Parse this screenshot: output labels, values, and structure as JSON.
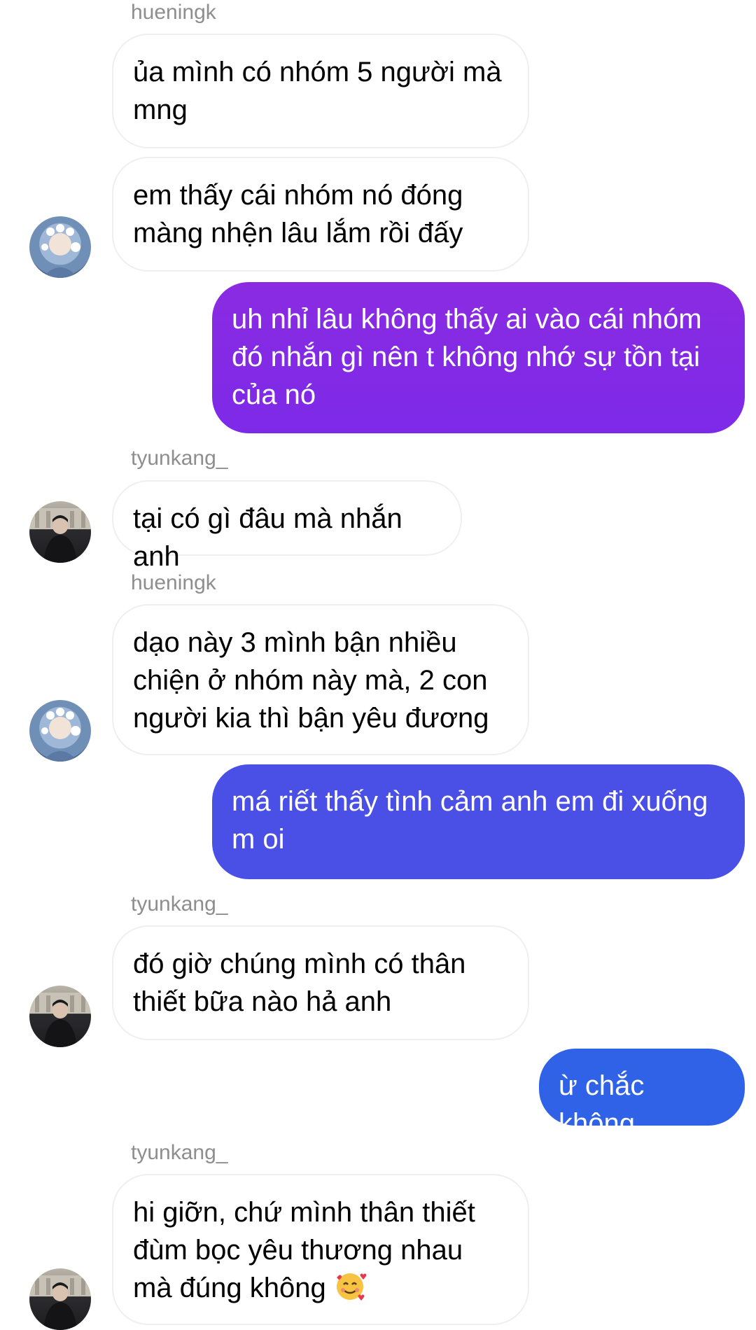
{
  "colors": {
    "sender_label": "#8e8e8e",
    "incoming_bubble": "#ffffff",
    "incoming_border": "#efefef",
    "outgoing_1": [
      "#8a2be2",
      "#7d2ae8"
    ],
    "outgoing_2": "#4a4fe6",
    "outgoing_3": "#2f62e6"
  },
  "senders": {
    "s1": "hueningk",
    "s2": "tyunkang_",
    "s3": "hueningk",
    "s4": "tyunkang_",
    "s5": "tyunkang_"
  },
  "messages": {
    "m1": "ủa mình có nhóm 5 người mà mng",
    "m2": "em thấy cái nhóm nó đóng màng nhện lâu lắm rồi đấy",
    "m3": "uh nhỉ lâu không thấy ai vào cái nhóm đó nhắn gì nên t không nhớ sự tồn tại của nó",
    "m4": "tại có gì đâu mà nhắn anh",
    "m5": "dạo này 3 mình bận nhiều chiện ở nhóm này mà, 2 con người kia thì bận yêu đương",
    "m6": "má riết thấy tình cảm anh em đi xuống m oi",
    "m7": "đó giờ chúng mình có thân thiết bữa nào hả anh",
    "m8": "ừ chắc không",
    "m9": "hi giỡn, chứ mình thân thiết đùm bọc yêu thương nhau mà đúng không"
  },
  "icons": {
    "m9_emoji": "smiling-face-with-hearts-icon"
  }
}
